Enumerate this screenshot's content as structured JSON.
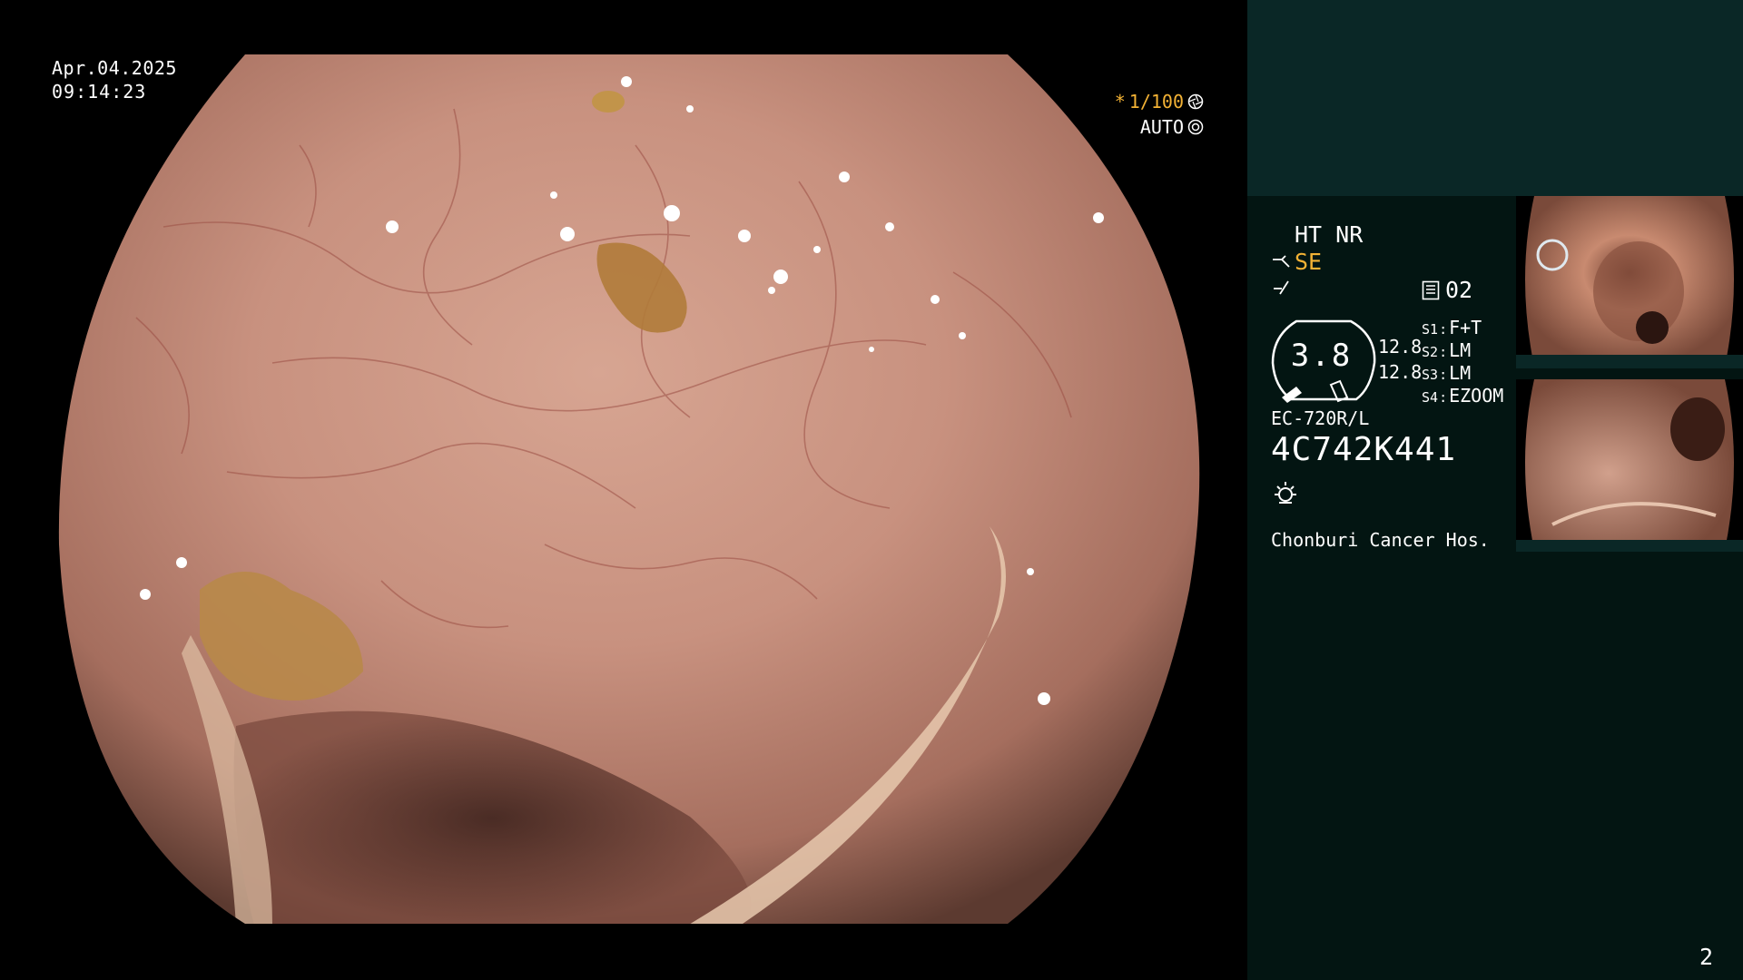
{
  "osd": {
    "date": "Apr.04.2025",
    "time": "09:14:23",
    "shutter": "1/100",
    "shutter_prefix": "*",
    "exposure_mode": "AUTO"
  },
  "panel": {
    "enhancement": "HT NR",
    "structure_mode": "SE",
    "mode_number": "02",
    "zoom_value": "3.8",
    "zoom_a": "12.8",
    "zoom_b": "12.8",
    "switches": [
      {
        "key": "S1",
        "value": "F+T"
      },
      {
        "key": "S2",
        "value": "LM"
      },
      {
        "key": "S3",
        "value": "LM"
      },
      {
        "key": "S4",
        "value": "EZOOM"
      }
    ],
    "scope_model": "EC-720R/L",
    "serial": "4C742K441",
    "hospital": "Chonburi Cancer Hos.",
    "page": "2"
  },
  "icons": {
    "shutter_icon": "aperture-icon",
    "auto_icon": "iris-icon",
    "structure_icon": "structure-enhance-icon",
    "contrast_icon": "contrast-icon",
    "mode_icon": "memory-icon",
    "light_icon": "light-source-icon"
  },
  "colors": {
    "accent": "#f3b235",
    "panel_bg": "#031512",
    "panel_top_bg": "#0a2726",
    "mucosa": "#c48e7d"
  }
}
